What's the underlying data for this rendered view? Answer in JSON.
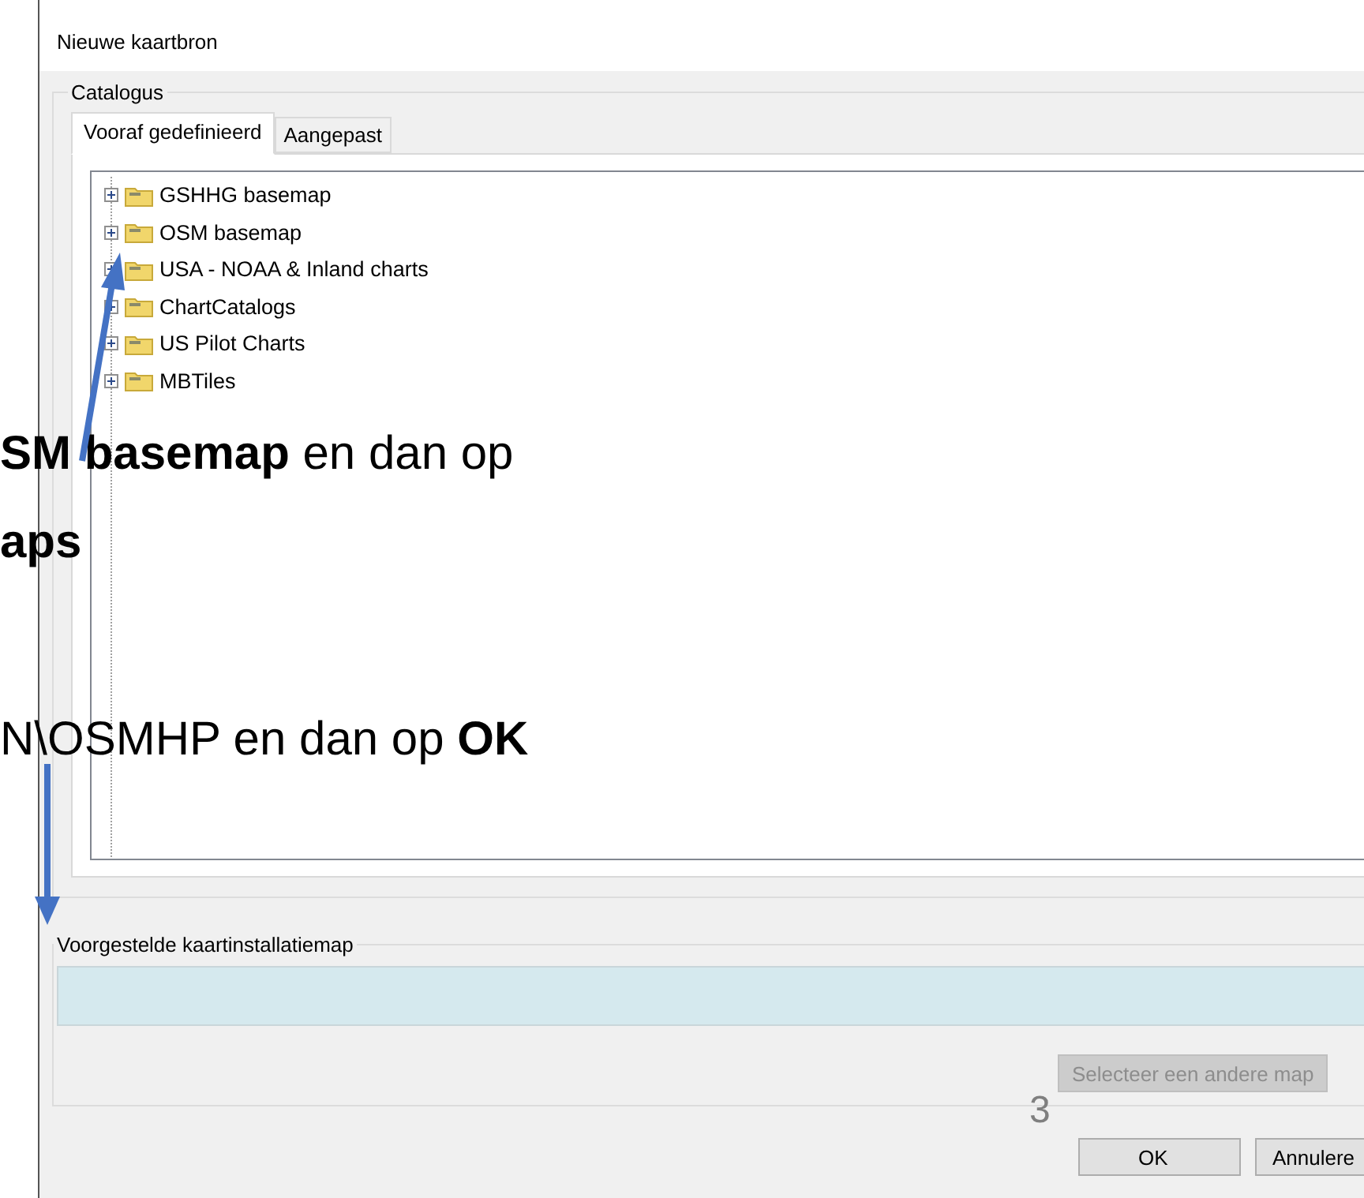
{
  "window": {
    "title": "Nieuwe kaartbron"
  },
  "catalog": {
    "label": "Catalogus",
    "tabs": [
      {
        "label": "Vooraf gedefinieerd",
        "selected": true
      },
      {
        "label": "Aangepast",
        "selected": false
      }
    ],
    "tree": [
      {
        "label": "GSHHG basemap",
        "expanded": false
      },
      {
        "label": "OSM basemap",
        "expanded": false
      },
      {
        "label": "USA - NOAA & Inland charts",
        "expanded": false
      },
      {
        "label": "ChartCatalogs",
        "expanded": false
      },
      {
        "label": "US Pilot Charts",
        "expanded": false
      },
      {
        "label": "MBTiles",
        "expanded": false
      }
    ]
  },
  "install_dir": {
    "label": "Voorgestelde kaartinstallatiemap",
    "select_button": {
      "label": "Selecteer een andere map",
      "disabled": true
    }
  },
  "buttons": [
    "OK",
    "Annulere"
  ],
  "annotations": [
    "**SM basemap** en dan op",
    "**aps**",
    "N\\OSMHP en dan op **OK**"
  ],
  "page_number": "3"
}
